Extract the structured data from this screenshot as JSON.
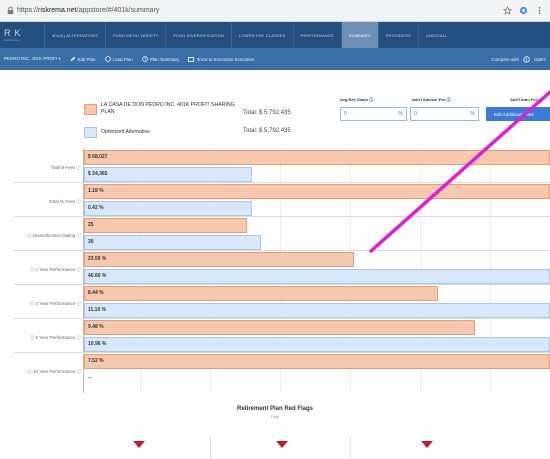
{
  "browser": {
    "url_prefix": "https://",
    "url_host": "riskrema.net",
    "url_path": "/appstore/#/401k/summary"
  },
  "app": {
    "logo_main": "RK",
    "logo_sub": "riskrema",
    "tabs": [
      "401(K) ALTERNATIVES",
      "FUND MENU VARIETY",
      "FUND DIVERSIFICATION",
      "LOWER FEE CLASSES",
      "PERFORMANCE",
      "SUMMARY",
      "PROVIDERS",
      "UNDO/ALL"
    ],
    "active_tab": 5
  },
  "toolbar": {
    "plan_name": "PEDRO INC. 401K PROFI ▾",
    "edit_plan": "Edit Plan",
    "load_plan": "Load Plan",
    "plan_summary": "Plan Summary",
    "executive": "Show to Executive Executive",
    "compare_with": "Compare with",
    "option": "Optim"
  },
  "legend": {
    "current_name": "LA CASA DE DON PEDRO INC. 401K PROFIT SHARING PLAN",
    "current_total": "Total: $ 5,792,435",
    "alternative_name": "Optimized Alternative",
    "alternative_total": "Total: $ 5,792,435",
    "current_color": "#f6c8ad",
    "alternative_color": "#d8e8fa"
  },
  "fees_form": {
    "avg_rev_share_label": "Avg Rev Share ⓘ",
    "avg_rev_share_value": "0",
    "avg_rev_share_unit": "%",
    "advisor_fee_label": "Add'l Advisor Fee ⓘ",
    "advisor_fee_value": "0",
    "advisor_fee_unit": "%",
    "admin_fee_label": "Add'l Adm Fee",
    "edit_button": "Edit Additional Fees"
  },
  "metrics": [
    {
      "label": "Total $ Fees ⓘ",
      "current_text": "$ 68,027",
      "alternative_text": "$ 24,365"
    },
    {
      "label": "Total % Fees ⓘ",
      "current_text": "1.18 %",
      "alternative_text": "0.42 %"
    },
    {
      "label": "ⓘ Diversification Rating ⓘ",
      "current_text": "25",
      "alternative_text": "30"
    },
    {
      "label": "ⓘ 1 Year Performance ⓘ",
      "current_text": "23.59 %",
      "alternative_text": "40.60 %"
    },
    {
      "label": "ⓘ 3 Year Performance ⓘ",
      "current_text": "8.44 %",
      "alternative_text": "11.10 %"
    },
    {
      "label": "ⓘ 5 Year Performance ⓘ",
      "current_text": "9.48 %",
      "alternative_text": "10.96 %"
    },
    {
      "label": "ⓘ 10 Year Performance ⓘ",
      "current_text": "7.52 %",
      "alternative_text": "--"
    }
  ],
  "chart_data": {
    "type": "bar",
    "orientation": "horizontal",
    "categories": [
      "Total $ Fees",
      "Total % Fees",
      "Diversification Rating",
      "1 Year Performance",
      "3 Year Performance",
      "5 Year Performance",
      "10 Year Performance"
    ],
    "series": [
      {
        "name": "LA CASA DE DON PEDRO INC. 401K PROFIT SHARING PLAN",
        "color": "#f6c8ad",
        "values": [
          68027,
          1.18,
          25,
          23.59,
          8.44,
          9.48,
          7.52
        ],
        "fill_fraction": [
          1.0,
          1.0,
          0.35,
          0.58,
          0.76,
          0.84,
          1.0
        ]
      },
      {
        "name": "Optimized Alternative",
        "color": "#d8e8fa",
        "values": [
          24365,
          0.42,
          30,
          40.6,
          11.1,
          10.96,
          null
        ],
        "fill_fraction": [
          0.36,
          0.36,
          0.38,
          1.0,
          1.0,
          1.0,
          0.0
        ]
      }
    ]
  },
  "red_flags": {
    "title": "Retirement Plan Red Flags",
    "subtitle": "Flags",
    "flag_color": "#b8202a"
  }
}
